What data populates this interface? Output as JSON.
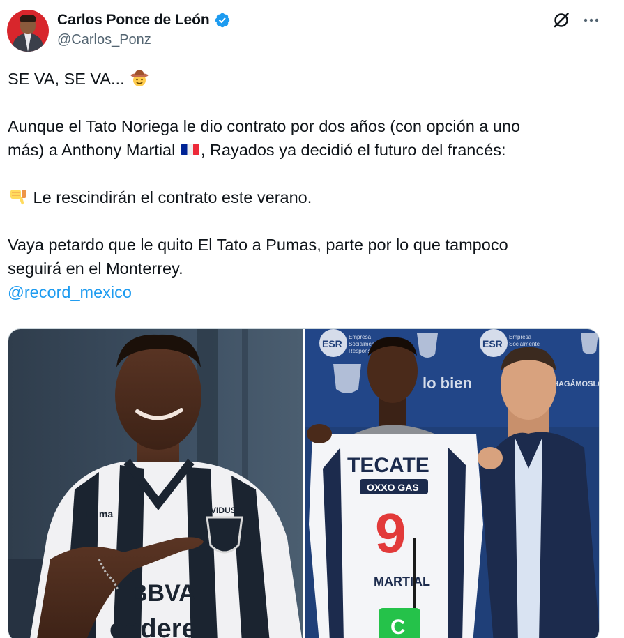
{
  "author": {
    "display_name": "Carlos Ponce de León",
    "handle": "@Carlos_Ponz",
    "verified": true,
    "avatar_color": "#d8262c"
  },
  "header_icons": [
    "grok-icon",
    "more-icon"
  ],
  "tweet": {
    "line1": "SE VA, SE VA...",
    "line1_emoji": "cowboy-hat-face",
    "para2_line1": "Aunque el Tato Noriega le dio contrato por dos años (con opción a uno",
    "para2_line2_a": "más) a Anthony Martial",
    "para2_line2_emoji": "france-flag",
    "para2_line2_b": ", Rayados ya decidió el futuro del francés:",
    "para3_emoji": "thumbs-down",
    "para3_text": "Le rescindirán el contrato este verano.",
    "para4_line1": "Vaya petardo que le quito El Tato a Pumas, parte por lo que tampoco",
    "para4_line2": "seguirá en el Monterrey.",
    "mention": "@record_mexico"
  },
  "media": {
    "left_photo": {
      "sponsors": [
        "Puma",
        "Vidusa",
        "BBVA",
        "codere"
      ]
    },
    "right_photo": {
      "backdrop": [
        "ESR Empresa Socialmente Responsable",
        "HAGÁMOSLO bien"
      ],
      "shirt_sponsors": [
        "TECATE",
        "OXXO GAS"
      ],
      "shirt_number": "9",
      "shirt_name": "MARTIAL"
    }
  },
  "colors": {
    "link": "#1d9bf0",
    "secondary_text": "#536471",
    "verified": "#1d9bf0"
  }
}
